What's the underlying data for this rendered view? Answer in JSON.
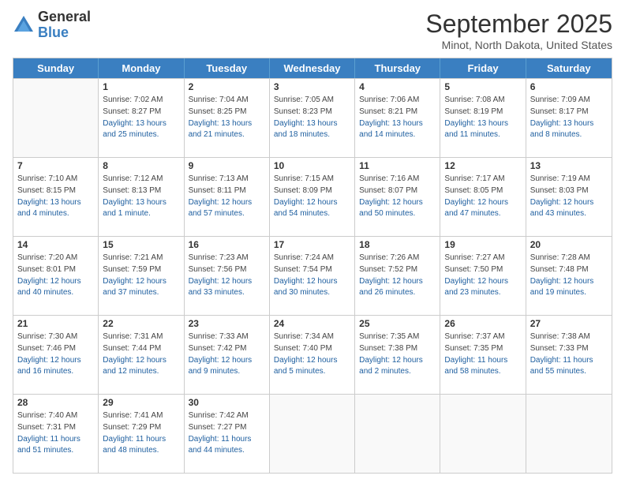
{
  "header": {
    "logo_general": "General",
    "logo_blue": "Blue",
    "month_title": "September 2025",
    "subtitle": "Minot, North Dakota, United States"
  },
  "weekdays": [
    "Sunday",
    "Monday",
    "Tuesday",
    "Wednesday",
    "Thursday",
    "Friday",
    "Saturday"
  ],
  "weeks": [
    [
      {
        "day": "",
        "sunrise": "",
        "sunset": "",
        "daylight": ""
      },
      {
        "day": "1",
        "sunrise": "Sunrise: 7:02 AM",
        "sunset": "Sunset: 8:27 PM",
        "daylight": "Daylight: 13 hours and 25 minutes."
      },
      {
        "day": "2",
        "sunrise": "Sunrise: 7:04 AM",
        "sunset": "Sunset: 8:25 PM",
        "daylight": "Daylight: 13 hours and 21 minutes."
      },
      {
        "day": "3",
        "sunrise": "Sunrise: 7:05 AM",
        "sunset": "Sunset: 8:23 PM",
        "daylight": "Daylight: 13 hours and 18 minutes."
      },
      {
        "day": "4",
        "sunrise": "Sunrise: 7:06 AM",
        "sunset": "Sunset: 8:21 PM",
        "daylight": "Daylight: 13 hours and 14 minutes."
      },
      {
        "day": "5",
        "sunrise": "Sunrise: 7:08 AM",
        "sunset": "Sunset: 8:19 PM",
        "daylight": "Daylight: 13 hours and 11 minutes."
      },
      {
        "day": "6",
        "sunrise": "Sunrise: 7:09 AM",
        "sunset": "Sunset: 8:17 PM",
        "daylight": "Daylight: 13 hours and 8 minutes."
      }
    ],
    [
      {
        "day": "7",
        "sunrise": "Sunrise: 7:10 AM",
        "sunset": "Sunset: 8:15 PM",
        "daylight": "Daylight: 13 hours and 4 minutes."
      },
      {
        "day": "8",
        "sunrise": "Sunrise: 7:12 AM",
        "sunset": "Sunset: 8:13 PM",
        "daylight": "Daylight: 13 hours and 1 minute."
      },
      {
        "day": "9",
        "sunrise": "Sunrise: 7:13 AM",
        "sunset": "Sunset: 8:11 PM",
        "daylight": "Daylight: 12 hours and 57 minutes."
      },
      {
        "day": "10",
        "sunrise": "Sunrise: 7:15 AM",
        "sunset": "Sunset: 8:09 PM",
        "daylight": "Daylight: 12 hours and 54 minutes."
      },
      {
        "day": "11",
        "sunrise": "Sunrise: 7:16 AM",
        "sunset": "Sunset: 8:07 PM",
        "daylight": "Daylight: 12 hours and 50 minutes."
      },
      {
        "day": "12",
        "sunrise": "Sunrise: 7:17 AM",
        "sunset": "Sunset: 8:05 PM",
        "daylight": "Daylight: 12 hours and 47 minutes."
      },
      {
        "day": "13",
        "sunrise": "Sunrise: 7:19 AM",
        "sunset": "Sunset: 8:03 PM",
        "daylight": "Daylight: 12 hours and 43 minutes."
      }
    ],
    [
      {
        "day": "14",
        "sunrise": "Sunrise: 7:20 AM",
        "sunset": "Sunset: 8:01 PM",
        "daylight": "Daylight: 12 hours and 40 minutes."
      },
      {
        "day": "15",
        "sunrise": "Sunrise: 7:21 AM",
        "sunset": "Sunset: 7:59 PM",
        "daylight": "Daylight: 12 hours and 37 minutes."
      },
      {
        "day": "16",
        "sunrise": "Sunrise: 7:23 AM",
        "sunset": "Sunset: 7:56 PM",
        "daylight": "Daylight: 12 hours and 33 minutes."
      },
      {
        "day": "17",
        "sunrise": "Sunrise: 7:24 AM",
        "sunset": "Sunset: 7:54 PM",
        "daylight": "Daylight: 12 hours and 30 minutes."
      },
      {
        "day": "18",
        "sunrise": "Sunrise: 7:26 AM",
        "sunset": "Sunset: 7:52 PM",
        "daylight": "Daylight: 12 hours and 26 minutes."
      },
      {
        "day": "19",
        "sunrise": "Sunrise: 7:27 AM",
        "sunset": "Sunset: 7:50 PM",
        "daylight": "Daylight: 12 hours and 23 minutes."
      },
      {
        "day": "20",
        "sunrise": "Sunrise: 7:28 AM",
        "sunset": "Sunset: 7:48 PM",
        "daylight": "Daylight: 12 hours and 19 minutes."
      }
    ],
    [
      {
        "day": "21",
        "sunrise": "Sunrise: 7:30 AM",
        "sunset": "Sunset: 7:46 PM",
        "daylight": "Daylight: 12 hours and 16 minutes."
      },
      {
        "day": "22",
        "sunrise": "Sunrise: 7:31 AM",
        "sunset": "Sunset: 7:44 PM",
        "daylight": "Daylight: 12 hours and 12 minutes."
      },
      {
        "day": "23",
        "sunrise": "Sunrise: 7:33 AM",
        "sunset": "Sunset: 7:42 PM",
        "daylight": "Daylight: 12 hours and 9 minutes."
      },
      {
        "day": "24",
        "sunrise": "Sunrise: 7:34 AM",
        "sunset": "Sunset: 7:40 PM",
        "daylight": "Daylight: 12 hours and 5 minutes."
      },
      {
        "day": "25",
        "sunrise": "Sunrise: 7:35 AM",
        "sunset": "Sunset: 7:38 PM",
        "daylight": "Daylight: 12 hours and 2 minutes."
      },
      {
        "day": "26",
        "sunrise": "Sunrise: 7:37 AM",
        "sunset": "Sunset: 7:35 PM",
        "daylight": "Daylight: 11 hours and 58 minutes."
      },
      {
        "day": "27",
        "sunrise": "Sunrise: 7:38 AM",
        "sunset": "Sunset: 7:33 PM",
        "daylight": "Daylight: 11 hours and 55 minutes."
      }
    ],
    [
      {
        "day": "28",
        "sunrise": "Sunrise: 7:40 AM",
        "sunset": "Sunset: 7:31 PM",
        "daylight": "Daylight: 11 hours and 51 minutes."
      },
      {
        "day": "29",
        "sunrise": "Sunrise: 7:41 AM",
        "sunset": "Sunset: 7:29 PM",
        "daylight": "Daylight: 11 hours and 48 minutes."
      },
      {
        "day": "30",
        "sunrise": "Sunrise: 7:42 AM",
        "sunset": "Sunset: 7:27 PM",
        "daylight": "Daylight: 11 hours and 44 minutes."
      },
      {
        "day": "",
        "sunrise": "",
        "sunset": "",
        "daylight": ""
      },
      {
        "day": "",
        "sunrise": "",
        "sunset": "",
        "daylight": ""
      },
      {
        "day": "",
        "sunrise": "",
        "sunset": "",
        "daylight": ""
      },
      {
        "day": "",
        "sunrise": "",
        "sunset": "",
        "daylight": ""
      }
    ]
  ]
}
